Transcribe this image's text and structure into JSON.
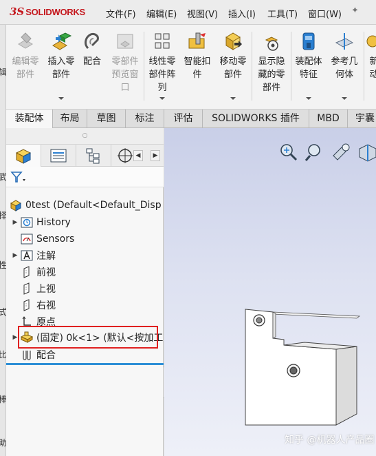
{
  "app": {
    "logo_ds": "3S",
    "logo_brand": "SOLIDWORKS"
  },
  "menu": [
    "文件(F)",
    "编辑(E)",
    "视图(V)",
    "插入(I)",
    "工具(T)",
    "窗口(W)"
  ],
  "ribbon": {
    "tools": [
      {
        "label": "编辑零\n部件",
        "enabled": false,
        "icon": "edit-component-icon"
      },
      {
        "label": "插入零\n部件",
        "enabled": true,
        "icon": "insert-component-icon"
      },
      {
        "label": "配合",
        "enabled": true,
        "icon": "mate-icon"
      },
      {
        "label": "零部件\n预览窗\n口",
        "enabled": false,
        "icon": "component-preview-icon"
      },
      {
        "label": "线性零\n部件阵\n列",
        "enabled": true,
        "icon": "linear-pattern-icon"
      },
      {
        "label": "智能扣\n件",
        "enabled": true,
        "icon": "smart-fasteners-icon"
      },
      {
        "label": "移动零\n部件",
        "enabled": true,
        "icon": "move-component-icon"
      },
      {
        "label": "显示隐\n藏的零\n部件",
        "enabled": true,
        "icon": "show-hidden-icon"
      },
      {
        "label": "装配体\n特征",
        "enabled": true,
        "icon": "assembly-feature-icon"
      },
      {
        "label": "参考几\n何体",
        "enabled": true,
        "icon": "reference-geometry-icon"
      },
      {
        "label": "新\n动",
        "enabled": true,
        "icon": "new-motion-icon"
      }
    ]
  },
  "tabs": [
    "装配体",
    "布局",
    "草图",
    "标注",
    "评估",
    "SOLIDWORKS 插件",
    "MBD",
    "宇囊"
  ],
  "left_strip_chars": [
    "辑",
    "武",
    "择",
    "性",
    "式",
    "比",
    "棒",
    "助"
  ],
  "tree": {
    "root": "0test  (Default<Default_Disp",
    "items": [
      {
        "label": "History",
        "expandable": true,
        "icon": "history-icon"
      },
      {
        "label": "Sensors",
        "expandable": false,
        "icon": "sensors-icon"
      },
      {
        "label": "注解",
        "expandable": true,
        "icon": "annotations-icon"
      },
      {
        "label": "前视",
        "expandable": false,
        "icon": "plane-icon"
      },
      {
        "label": "上视",
        "expandable": false,
        "icon": "plane-icon"
      },
      {
        "label": "右视",
        "expandable": false,
        "icon": "plane-icon"
      },
      {
        "label": "原点",
        "expandable": false,
        "icon": "origin-icon"
      },
      {
        "label": "(固定) 0k<1> (默认<按加工",
        "expandable": true,
        "icon": "part-icon"
      },
      {
        "label": "配合",
        "expandable": false,
        "icon": "mates-folder-icon"
      }
    ]
  },
  "watermark": "知乎 @机器人产品圈",
  "colors": {
    "brand_red": "#c4161c",
    "highlight_red": "#e02020",
    "selection_blue": "#2e8fd6"
  }
}
